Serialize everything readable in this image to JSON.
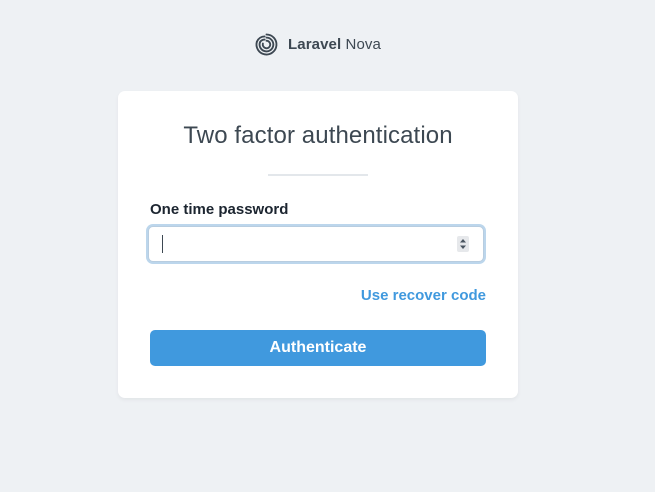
{
  "logo": {
    "brand": "Laravel",
    "product": "Nova",
    "icon": "laravel-nova-swirl-icon",
    "color": "#3d4852"
  },
  "card": {
    "title": "Two factor authentication",
    "field_label": "One time password",
    "input": {
      "value": "",
      "placeholder": ""
    },
    "recover_link": "Use recover code",
    "submit_label": "Authenticate"
  },
  "colors": {
    "background": "#eef1f4",
    "card": "#ffffff",
    "accent": "#4099de",
    "text": "#3d4852",
    "label": "#1c2530"
  }
}
